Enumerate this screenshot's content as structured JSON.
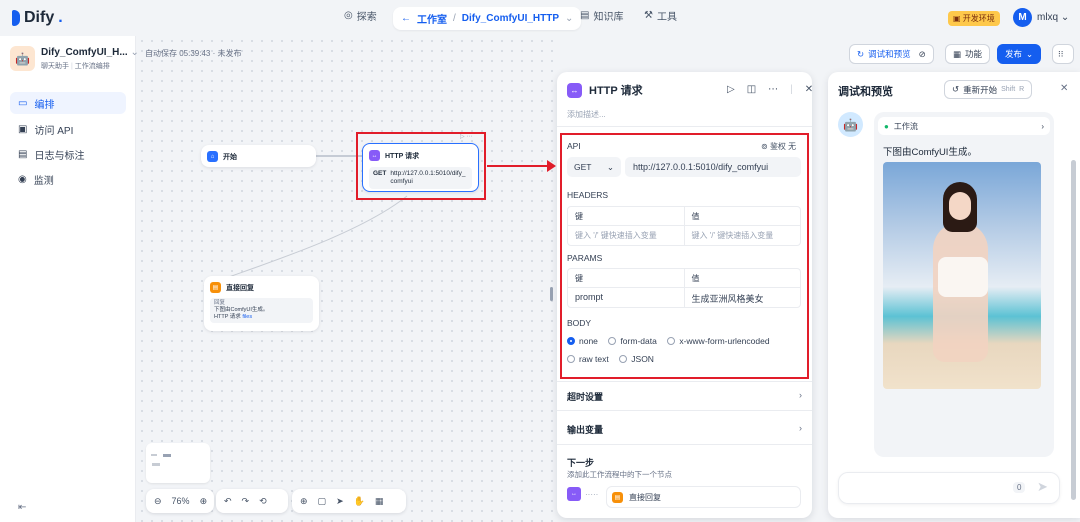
{
  "topbar": {
    "logo": "Dify",
    "explore": "探索",
    "studio": "工作室",
    "app_name": "Dify_ComfyUI_HTTP",
    "knowledge": "知识库",
    "tools": "工具",
    "env_badge": "开发环境",
    "avatar_letter": "M",
    "username": "mlxq"
  },
  "sidebar": {
    "app_name": "Dify_ComfyUI_H...",
    "app_type_1": "聊天助手",
    "app_type_2": "工作流编排",
    "items": [
      {
        "label": "编排",
        "icon": "orchestrate-icon"
      },
      {
        "label": "访问 API",
        "icon": "terminal-icon"
      },
      {
        "label": "日志与标注",
        "icon": "log-icon"
      },
      {
        "label": "监测",
        "icon": "monitor-icon"
      }
    ]
  },
  "canvas": {
    "autosave": "自动保存 05:39:43 · 未发布",
    "start_node": "开始",
    "http_node": {
      "title": "HTTP 请求",
      "method": "GET",
      "url": "http://127.0.0.1:5010/dify_comfyui"
    },
    "answer_node": {
      "title": "直接回复",
      "label": "回复",
      "text": "下图由ComfyUI生成。",
      "var_node": "HTTP 请求",
      "var_name": "files"
    },
    "zoom": "76%"
  },
  "header_actions": {
    "run_preview": "调试和预览",
    "features": "功能",
    "publish": "发布"
  },
  "panel": {
    "title": "HTTP 请求",
    "description_placeholder": "添加描述...",
    "api_label": "API",
    "auth": "鉴权 无",
    "method": "GET",
    "url": "http://127.0.0.1:5010/dify_comfyui",
    "headers_label": "HEADERS",
    "key_col": "键",
    "value_col": "值",
    "key_placeholder": "键入 '/' 键快速插入变量",
    "value_placeholder": "键入 '/' 键快速插入变量",
    "params_label": "PARAMS",
    "param_key": "prompt",
    "param_value": "生成亚洲风格美女",
    "body_label": "BODY",
    "body_options": [
      "none",
      "form-data",
      "x-www-form-urlencoded",
      "raw text",
      "JSON"
    ],
    "body_selected": "none",
    "timeout": "超时设置",
    "output_vars": "输出变量",
    "next_step": "下一步",
    "next_step_desc": "添加此工作流程中的下一个节点",
    "next_node": "直接回复"
  },
  "preview": {
    "title": "调试和预览",
    "restart": "重新开始",
    "shortcut_1": "Shift",
    "shortcut_2": "R",
    "workflow_tag": "工作流",
    "message": "下图由ComfyUI生成。",
    "char_count": "0"
  },
  "colors": {
    "accent": "#155eef",
    "highlight": "#e11d2a",
    "http_icon": "#875bf7",
    "answer_icon": "#f79009",
    "start_icon": "#2970ff"
  }
}
